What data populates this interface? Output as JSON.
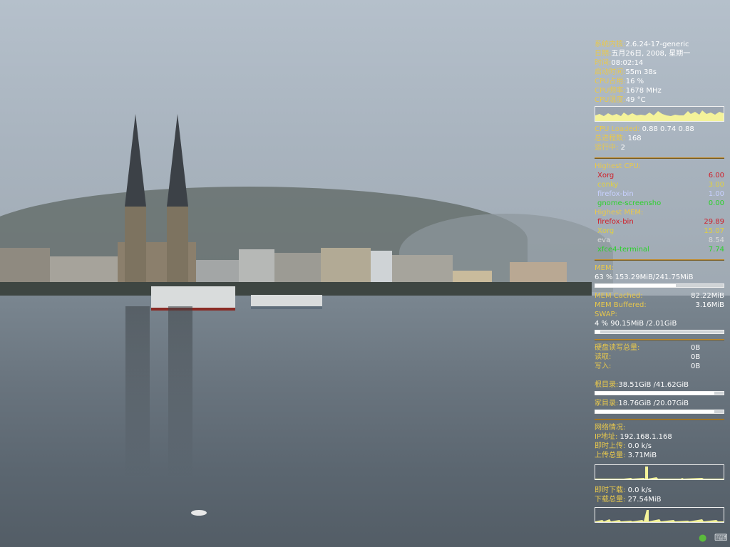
{
  "system": {
    "kernel_label": "系统内核:",
    "kernel_value": "2.6.24-17-generic",
    "date_label": "日期:",
    "date_value": "五月26日, 2008, 星期一",
    "time_label": "时间:",
    "time_value": "08:02:14",
    "uptime_label": "启动时间:",
    "uptime_value": "55m 38s",
    "cpu_usage_label": "CPU占用:",
    "cpu_usage_value": "16 %",
    "cpu_freq_label": "CPU频率:",
    "cpu_freq_value": "1678 MHz",
    "cpu_temp_label": "CPU温度:",
    "cpu_temp_value": "49  °C"
  },
  "load": {
    "loaded_label": "CPU Loaded:",
    "loaded_value": "0.88 0.74 0.88",
    "processes_label": "总进程数:",
    "processes_value": "168",
    "running_label": "运行中:",
    "running_value": "2"
  },
  "highest_cpu": {
    "title": "Highest CPU:",
    "rows": [
      {
        "name": "Xorg",
        "value": "6.00"
      },
      {
        "name": "conky",
        "value": "3.00"
      },
      {
        "name": "firefox-bin",
        "value": "1.00"
      },
      {
        "name": "gnome-screensho",
        "value": "0.00"
      }
    ]
  },
  "highest_mem": {
    "title": "Highest MEM:",
    "rows": [
      {
        "name": "firefox-bin",
        "value": "29.89"
      },
      {
        "name": "Xorg",
        "value": "15.07"
      },
      {
        "name": "eva",
        "value": "8.54"
      },
      {
        "name": "xfce4-terminal",
        "value": "7.74"
      }
    ]
  },
  "memory": {
    "mem_label": "MEM:",
    "mem_value": "63 % 153.29MiB/241.75MiB",
    "mem_fraction": 0.63,
    "cached_label": "MEM Cached:",
    "cached_value": "82.22MiB",
    "buffered_label": "MEM Buffered:",
    "buffered_value": "3.16MiB",
    "swap_label": "SWAP:",
    "swap_value": "4  % 90.15MiB /2.01GiB",
    "swap_fraction": 0.04
  },
  "disk": {
    "io_label": "硬盘读写总量:",
    "io_value": "0B",
    "read_label": "读取:",
    "read_value": "0B",
    "write_label": "写入:",
    "write_value": "0B",
    "root_label": "根目录:",
    "root_value": "38.51GiB /41.62GiB",
    "root_fraction": 0.93,
    "home_label": "家目录:",
    "home_value": "18.76GiB /20.07GiB",
    "home_fraction": 0.93
  },
  "network": {
    "title": "网络情况:",
    "ip_label": "IP地址:",
    "ip_value": "192.168.1.168",
    "up_label": "即时上传:",
    "up_value": "0.0    k/s",
    "up_total_label": "上传总量:",
    "up_total_value": "3.71MiB",
    "down_label": "即时下载:",
    "down_value": "0.0    k/s",
    "down_total_label": "下载总量:",
    "down_total_value": "27.54MiB"
  },
  "tray": {
    "icons": [
      "user-status-icon",
      "keyboard-icon"
    ]
  },
  "colors": {
    "label": "#e8c84c",
    "value": "#ffffff",
    "separator": "#c08a2a",
    "graph": "#f4f39a"
  }
}
